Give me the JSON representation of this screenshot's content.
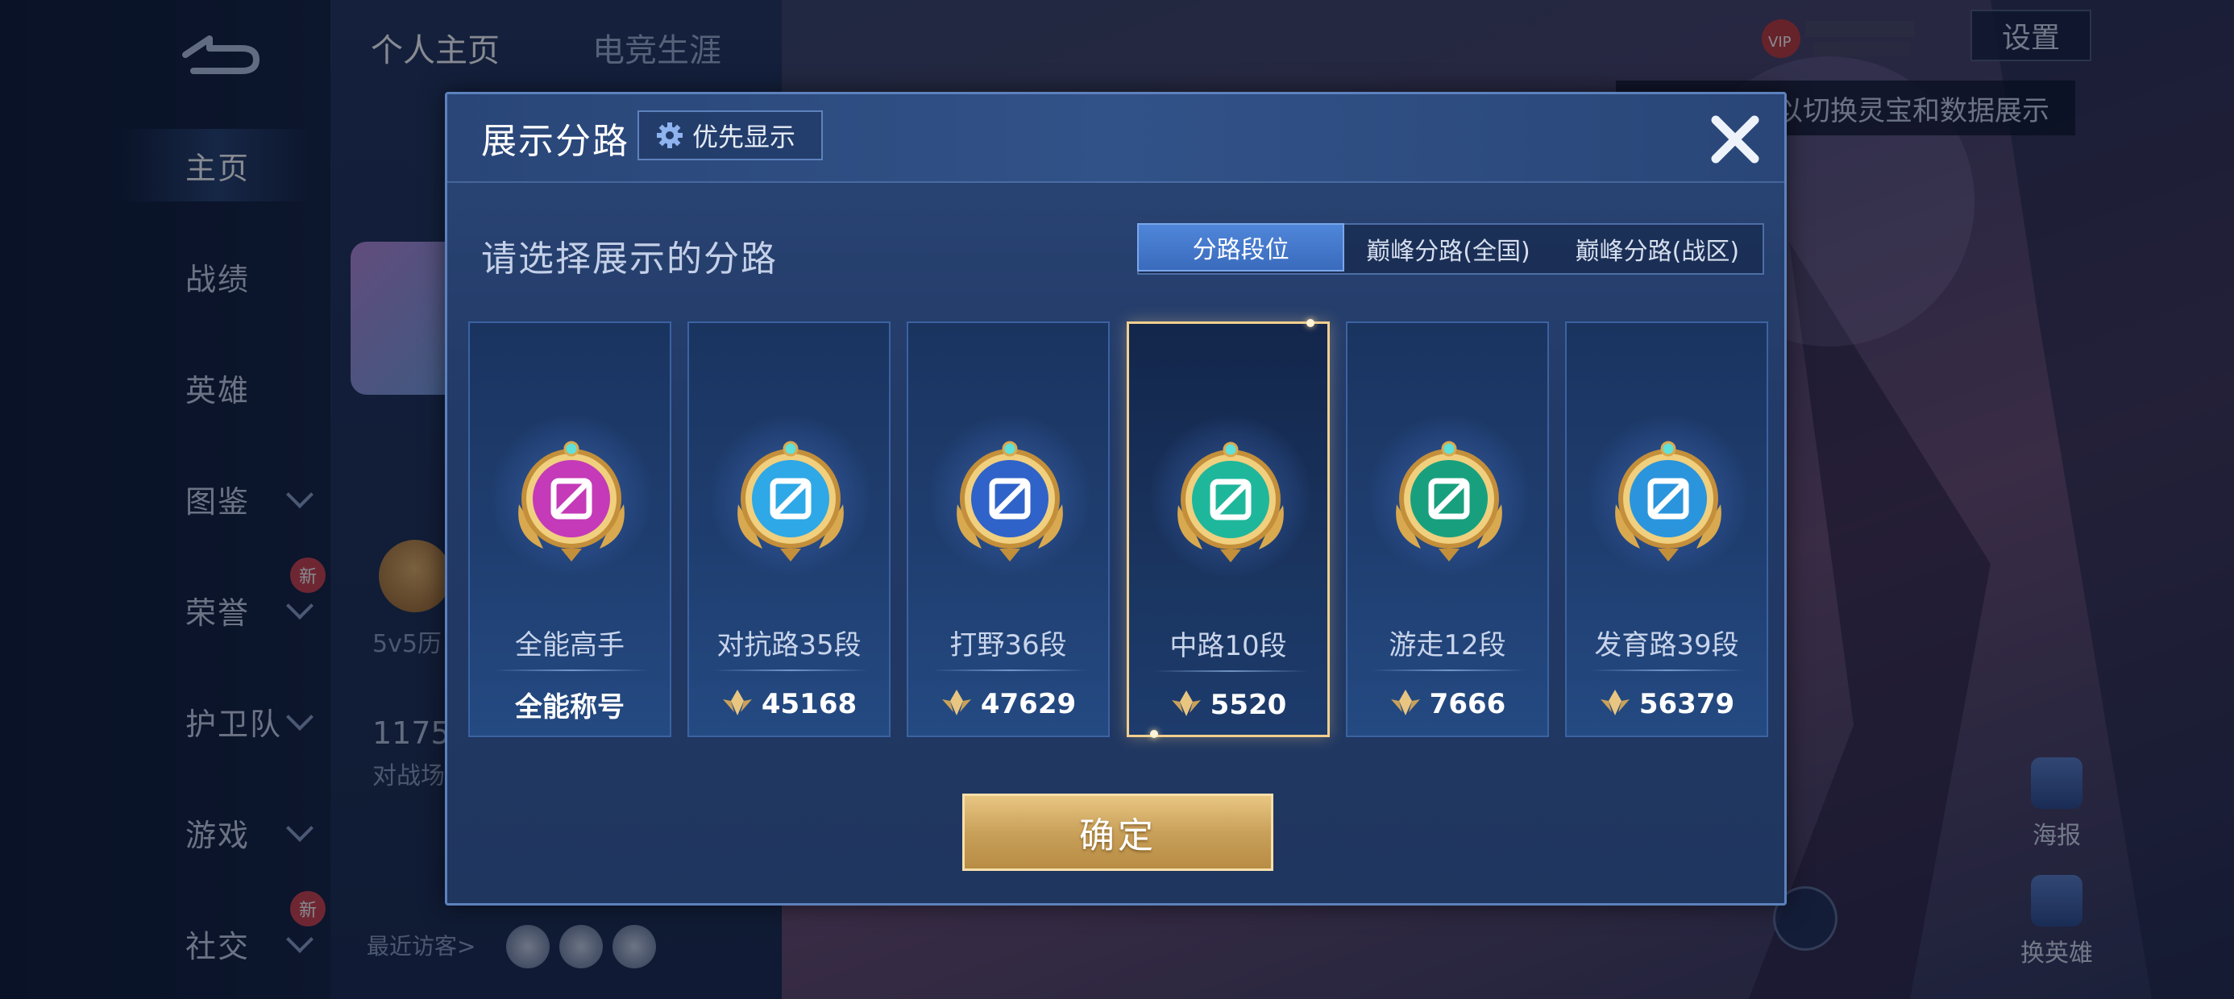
{
  "background": {
    "top_tabs": [
      "个人主页",
      "电竞生涯"
    ],
    "nav_items": [
      {
        "label": "主页",
        "active": true
      },
      {
        "label": "战绩",
        "active": false
      },
      {
        "label": "英雄",
        "active": false
      },
      {
        "label": "图鉴",
        "active": false,
        "expandable": true
      },
      {
        "label": "荣誉",
        "active": false,
        "expandable": true,
        "badge": "新"
      },
      {
        "label": "护卫队",
        "active": false,
        "expandable": true
      },
      {
        "label": "游戏",
        "active": false,
        "expandable": true
      },
      {
        "label": "社交",
        "active": false,
        "expandable": true,
        "badge": "新"
      }
    ],
    "rank_text": "5v5历",
    "battle_count": "1175",
    "battle_text": "对战场",
    "recent_visitors_label": "最近访客>",
    "settings_label": "设置",
    "hint_text": "以切换灵宝和数据展示",
    "poster_label": "海报",
    "swap_hero_label": "换英雄"
  },
  "modal": {
    "title": "展示分路",
    "priority_button": "优先显示",
    "subtitle": "请选择展示的分路",
    "tabs": [
      {
        "label": "分路段位",
        "selected": true
      },
      {
        "label": "巅峰分路(全国)",
        "selected": false
      },
      {
        "label": "巅峰分路(战区)",
        "selected": false
      }
    ],
    "cards": [
      {
        "label": "全能高手",
        "value": "全能称号",
        "has_peak_icon": false,
        "selected": false,
        "emblem_color": "#c43ab8",
        "emblem": "all-round-emblem-icon"
      },
      {
        "label": "对抗路35段",
        "value": "45168",
        "has_peak_icon": true,
        "selected": false,
        "emblem_color": "#2ea8e6",
        "emblem": "clash-lane-emblem-icon"
      },
      {
        "label": "打野36段",
        "value": "47629",
        "has_peak_icon": true,
        "selected": false,
        "emblem_color": "#2f63c9",
        "emblem": "jungle-emblem-icon"
      },
      {
        "label": "中路10段",
        "value": "5520",
        "has_peak_icon": true,
        "selected": true,
        "emblem_color": "#1fb79b",
        "emblem": "mid-lane-emblem-icon"
      },
      {
        "label": "游走12段",
        "value": "7666",
        "has_peak_icon": true,
        "selected": false,
        "emblem_color": "#18a07e",
        "emblem": "roam-emblem-icon"
      },
      {
        "label": "发育路39段",
        "value": "56379",
        "has_peak_icon": true,
        "selected": false,
        "emblem_color": "#2a95dd",
        "emblem": "farm-lane-emblem-icon"
      }
    ],
    "confirm_button": "确定"
  },
  "colors": {
    "modal_bg": "#223a67",
    "accent_blue": "#4f86d9",
    "gold": "#c9a15a",
    "selected_border": "#f2cf8f"
  }
}
